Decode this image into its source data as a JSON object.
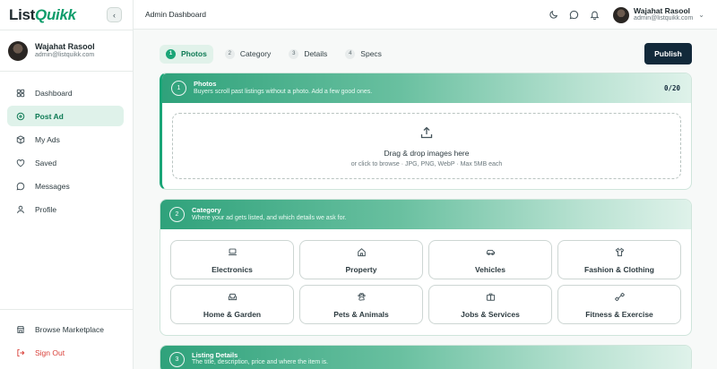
{
  "brand": {
    "name_main": "List",
    "name_accent": "Quikk"
  },
  "user": {
    "name": "Wajahat Rasool",
    "email": "admin@listquikk.com"
  },
  "sidebar": {
    "items": [
      {
        "label": "Dashboard",
        "icon": "grid-icon",
        "active": false
      },
      {
        "label": "Post Ad",
        "icon": "plus-circle-icon",
        "active": true
      },
      {
        "label": "My Ads",
        "icon": "box-icon",
        "active": false
      },
      {
        "label": "Saved",
        "icon": "heart-icon",
        "active": false
      },
      {
        "label": "Messages",
        "icon": "chat-icon",
        "active": false
      },
      {
        "label": "Profile",
        "icon": "user-icon",
        "active": false
      }
    ],
    "bottom": [
      {
        "label": "Browse Marketplace",
        "icon": "store-icon"
      },
      {
        "label": "Sign Out",
        "icon": "logout-icon"
      }
    ]
  },
  "topbar": {
    "title": "Admin Dashboard"
  },
  "steps": [
    {
      "num": "1",
      "label": "Photos"
    },
    {
      "num": "2",
      "label": "Category"
    },
    {
      "num": "3",
      "label": "Details"
    },
    {
      "num": "4",
      "label": "Specs"
    }
  ],
  "publish_label": "Publish",
  "photos_card": {
    "num": "1",
    "title": "Photos",
    "subtitle": "Buyers scroll past listings without a photo. Add a few good ones.",
    "counter": "0/20",
    "drop_title": "Drag & drop images here",
    "drop_hint": "or click to browse · JPG, PNG, WebP · Max 5MB each"
  },
  "category_card": {
    "num": "2",
    "title": "Category",
    "subtitle": "Where your ad gets listed, and which details we ask for.",
    "categories": [
      {
        "label": "Electronics",
        "icon": "laptop-icon"
      },
      {
        "label": "Property",
        "icon": "house-icon"
      },
      {
        "label": "Vehicles",
        "icon": "car-icon"
      },
      {
        "label": "Fashion & Clothing",
        "icon": "shirt-icon"
      },
      {
        "label": "Home & Garden",
        "icon": "sofa-icon"
      },
      {
        "label": "Pets & Animals",
        "icon": "paw-icon"
      },
      {
        "label": "Jobs & Services",
        "icon": "briefcase-icon"
      },
      {
        "label": "Fitness & Exercise",
        "icon": "dumbbell-icon"
      }
    ]
  },
  "details_card": {
    "num": "3",
    "title": "Listing Details",
    "subtitle": "The title, description, price and where the item is."
  },
  "colors": {
    "accent": "#1aa577",
    "dark": "#12293a",
    "danger": "#d9413a"
  }
}
